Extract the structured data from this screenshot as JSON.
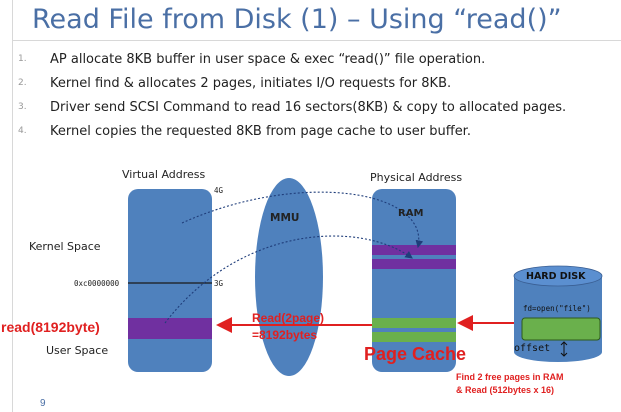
{
  "title": "Read File from Disk (1) – Using “read()”",
  "steps": [
    {
      "num": "1.",
      "text": "AP  allocate 8KB buffer in user space & exec “read()” file operation."
    },
    {
      "num": "2.",
      "text": "Kernel find & allocates 2 pages, initiates I/O requests for 8KB."
    },
    {
      "num": "3.",
      "text": "Driver send SCSI Command to read 16 sectors(8KB) & copy to allocated pages."
    },
    {
      "num": "4.",
      "text": "Kernel copies the requested 8KB from page cache to user buffer."
    }
  ],
  "diagram": {
    "virtual_address": "Virtual Address",
    "label_4g": "4G",
    "label_3g": "3G",
    "kernel_space": "Kernel Space",
    "user_space": "User Space",
    "addr_0xc": "0xc0000000",
    "read_call": "read(8192byte)",
    "mmu": "MMU",
    "physical_address": "Physical Address",
    "ram": "RAM",
    "read_pages_1": "Read(2page)",
    "read_pages_2": "=8192bytes",
    "page_cache": "Page Cache",
    "hard_disk": "HARD DISK",
    "fd_open": "fd=open(\"file\")",
    "offset": "offset",
    "note_1": "Find 2 free pages in RAM",
    "note_2": "& Read (512bytes x 16)"
  },
  "page_number": "9",
  "colors": {
    "title": "#4a6fa5",
    "block_fill": "#4f81bd",
    "purple": "#7030a0",
    "green": "#6ab04c",
    "arrow_red": "#e02020"
  }
}
